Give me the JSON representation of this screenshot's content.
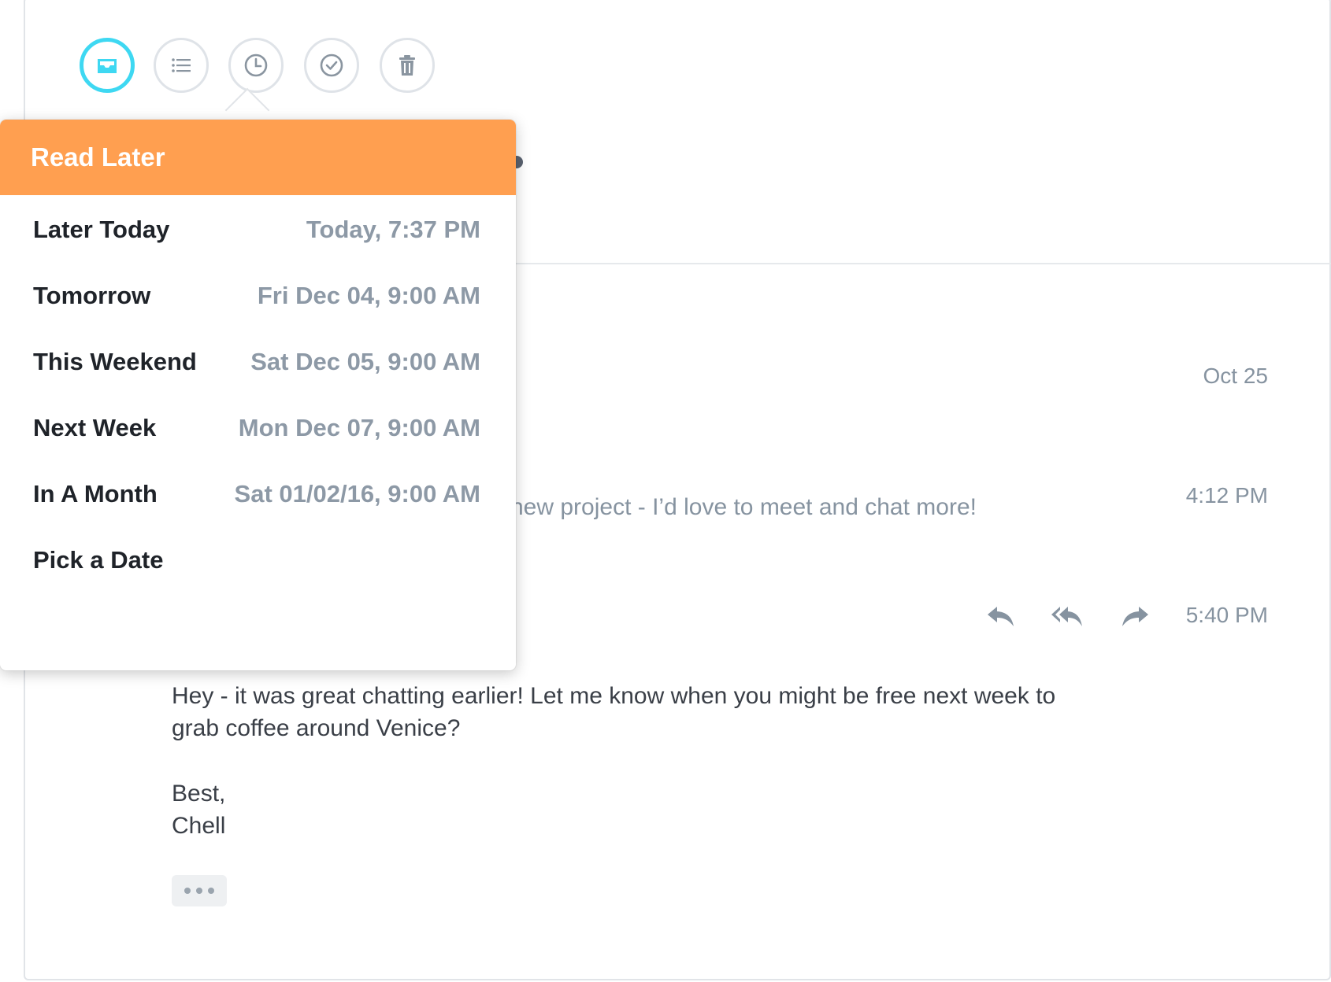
{
  "toolbar": {
    "buttons": [
      {
        "name": "inbox-button",
        "icon": "inbox-tray-icon",
        "active": true
      },
      {
        "name": "list-button",
        "icon": "list-icon",
        "active": false
      },
      {
        "name": "read-later-button",
        "icon": "clock-icon",
        "active": false
      },
      {
        "name": "done-button",
        "icon": "checkmark-circle-icon",
        "active": false
      },
      {
        "name": "delete-button",
        "icon": "trash-icon",
        "active": false
      }
    ],
    "accent_color": "#3ed8f2"
  },
  "popover": {
    "title": "Read Later",
    "header_color": "#ff9f50",
    "options": [
      {
        "label": "Later Today",
        "when": "Today, 7:37 PM"
      },
      {
        "label": "Tomorrow",
        "when": "Fri Dec 04, 9:00 AM"
      },
      {
        "label": "This Weekend",
        "when": "Sat Dec 05, 9:00 AM"
      },
      {
        "label": "Next Week",
        "when": "Mon Dec 07, 9:00 AM"
      },
      {
        "label": "In A Month",
        "when": "Sat 01/02/16, 9:00 AM"
      },
      {
        "label": "Pick a Date",
        "when": ""
      }
    ]
  },
  "thread": {
    "messages": [
      {
        "time": "Oct 25"
      },
      {
        "time": "4:12 PM",
        "snippet": "new project - I’d love to meet and chat more!"
      },
      {
        "time": "5:40 PM"
      }
    ],
    "actions": [
      {
        "name": "reply-button",
        "icon": "reply-icon"
      },
      {
        "name": "reply-all-button",
        "icon": "reply-all-icon"
      },
      {
        "name": "forward-button",
        "icon": "forward-icon"
      }
    ],
    "body": {
      "line1": "Hey - it was great chatting earlier! Let me know when you might be free next week to",
      "line2": "grab coffee around Venice?",
      "signoff": "Best,",
      "signature": "Chell"
    },
    "more_icon": "ellipsis-icon"
  }
}
